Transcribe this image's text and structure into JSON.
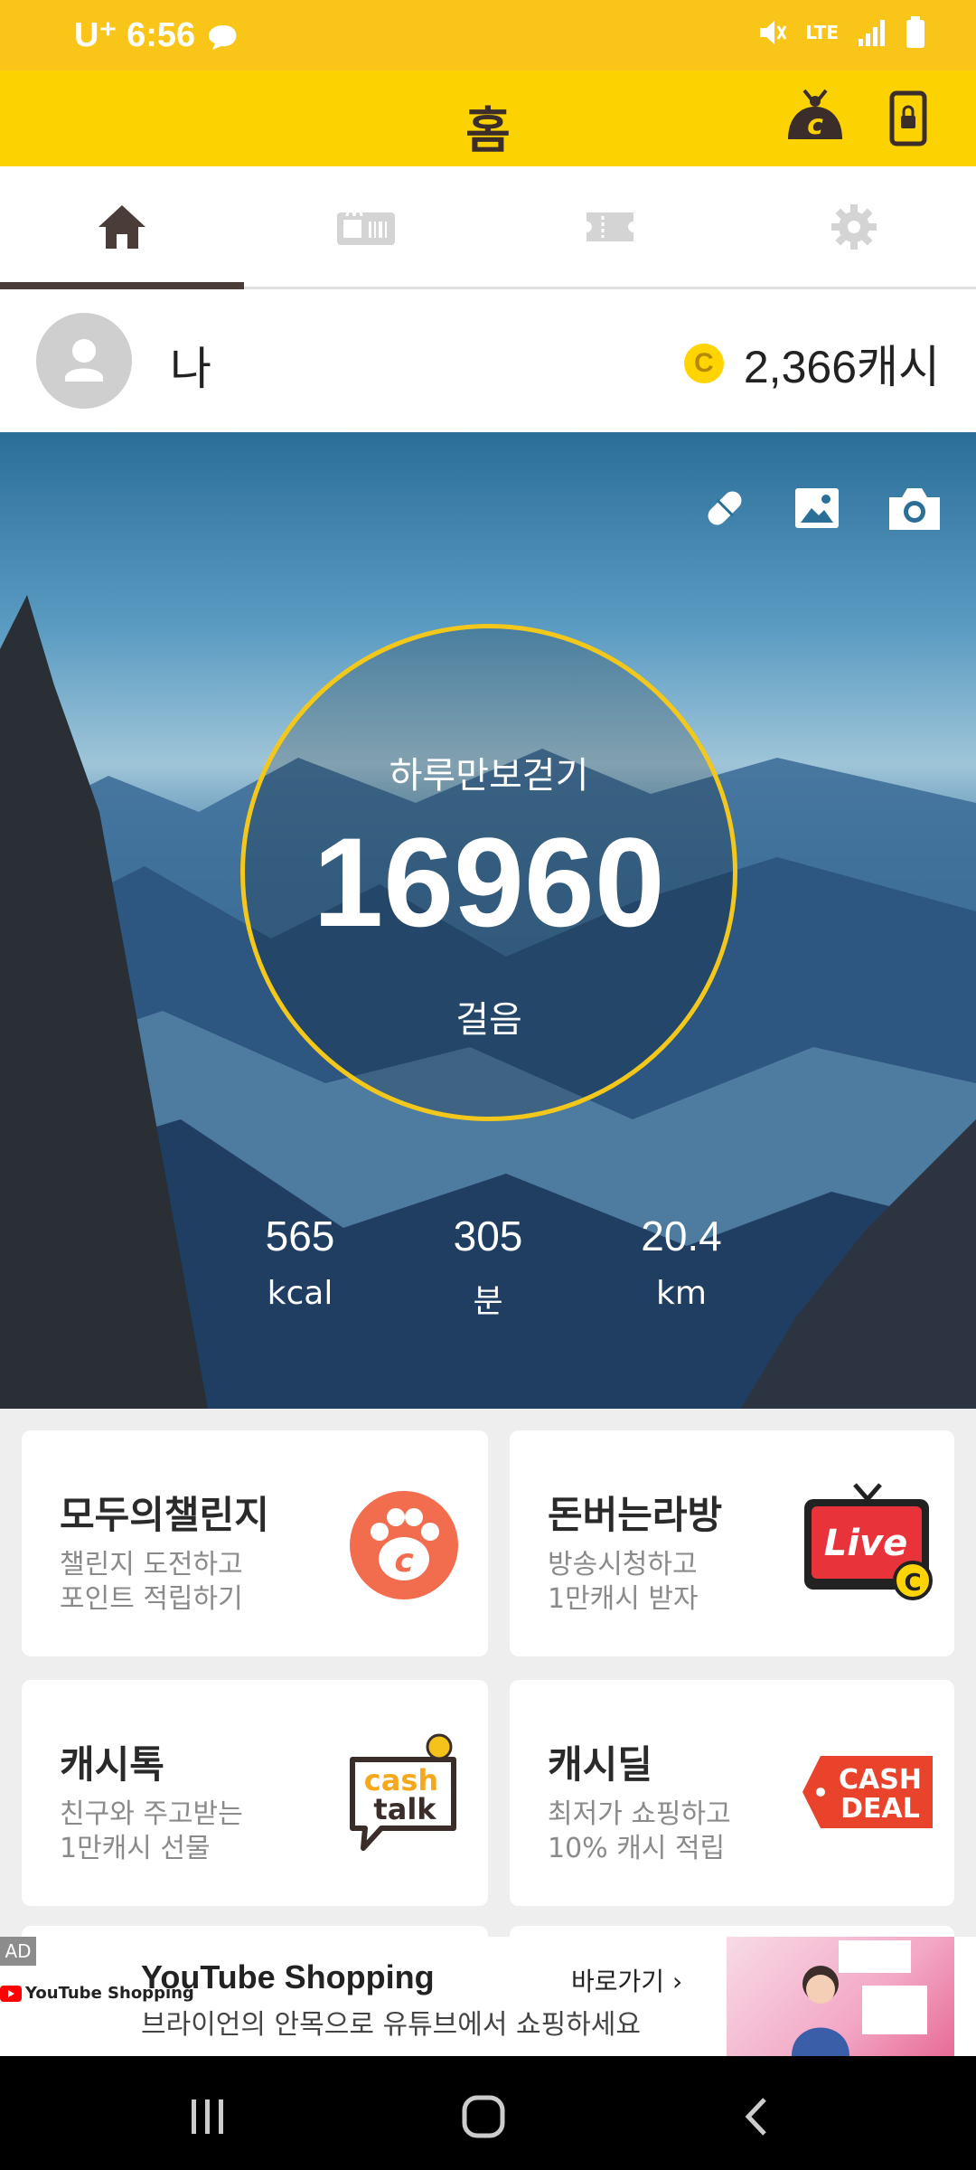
{
  "status_bar": {
    "carrier": "U⁺",
    "time": "6:56",
    "network": "LTE"
  },
  "app_bar": {
    "title": "홈"
  },
  "tabs": [
    {
      "name": "home",
      "active": true
    },
    {
      "name": "coupon",
      "active": false
    },
    {
      "name": "ticket",
      "active": false
    },
    {
      "name": "settings",
      "active": false
    }
  ],
  "profile": {
    "name": "나",
    "cash": "2,366캐시",
    "coin_symbol": "C"
  },
  "pedometer": {
    "label": "하루만보걷기",
    "steps": "16960",
    "unit": "걸음",
    "stats": [
      {
        "value": "565",
        "unit": "kcal"
      },
      {
        "value": "305",
        "unit": "분"
      },
      {
        "value": "20.4",
        "unit": "km"
      }
    ]
  },
  "cards": [
    {
      "title": "모두의챌린지",
      "sub1": "챌린지 도전하고",
      "sub2": "포인트 적립하기"
    },
    {
      "title": "돈버는라방",
      "sub1": "방송시청하고",
      "sub2": "1만캐시 받자",
      "art_text": "Live"
    },
    {
      "title": "캐시톡",
      "sub1": "친구와 주고받는",
      "sub2": "1만캐시 선물",
      "art_text1": "cash",
      "art_text2": "talk"
    },
    {
      "title": "캐시딜",
      "sub1": "최저가 쇼핑하고",
      "sub2": "10% 캐시 적립",
      "art_text1": "CASH",
      "art_text2": "DEAL"
    }
  ],
  "ad": {
    "tag": "AD",
    "brand": "YouTube Shopping",
    "headline": "YouTube Shopping",
    "description": "브라이언의 안목으로 유튜브에서 쇼핑하세요",
    "cta": "바로가기"
  },
  "colors": {
    "brand_yellow": "#fcd200",
    "status_yellow": "#f9c518",
    "ring_yellow": "#f3c81b",
    "live_red": "#e8333a",
    "deal_red": "#e9432c",
    "challenge_orange": "#f26d4e"
  }
}
